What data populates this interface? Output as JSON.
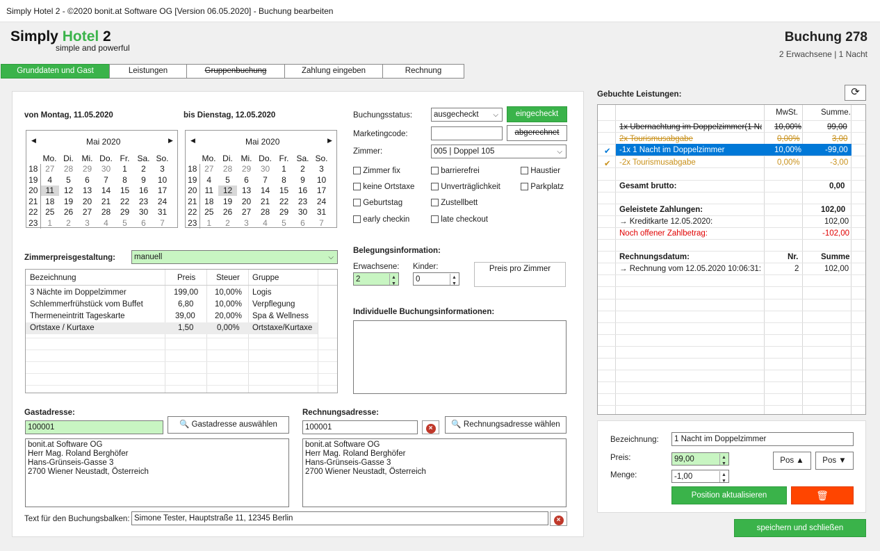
{
  "window_title": "Simply Hotel 2 - ©2020 bonit.at Software OG [Version 06.05.2020] - Buchung bearbeiten",
  "logo": {
    "a": "Simply",
    "b": "Hotel",
    "c": "2",
    "tagline": "simple and powerful"
  },
  "booking": {
    "title": "Buchung 278",
    "subtitle": "2 Erwachsene | 1 Nacht"
  },
  "tabs": [
    "Grunddaten und Gast",
    "Leistungen",
    "Gruppenbuchung",
    "Zahlung eingeben",
    "Rechnung"
  ],
  "from_label": "von Montag, 11.05.2020",
  "to_label": "bis Dienstag, 12.05.2020",
  "cal1": {
    "month": "Mai 2020",
    "days": [
      "Mo.",
      "Di.",
      "Mi.",
      "Do.",
      "Fr.",
      "Sa.",
      "So."
    ],
    "weeks": [
      [
        "18",
        "27",
        "28",
        "29",
        "30",
        "1",
        "2",
        "3"
      ],
      [
        "19",
        "4",
        "5",
        "6",
        "7",
        "8",
        "9",
        "10"
      ],
      [
        "20",
        "11",
        "12",
        "13",
        "14",
        "15",
        "16",
        "17"
      ],
      [
        "21",
        "18",
        "19",
        "20",
        "21",
        "22",
        "23",
        "24"
      ],
      [
        "22",
        "25",
        "26",
        "27",
        "28",
        "29",
        "30",
        "31"
      ],
      [
        "23",
        "1",
        "2",
        "3",
        "4",
        "5",
        "6",
        "7"
      ]
    ]
  },
  "cal2": {
    "month": "Mai 2020",
    "days": [
      "Mo.",
      "Di.",
      "Mi.",
      "Do.",
      "Fr.",
      "Sa.",
      "So."
    ]
  },
  "status": {
    "label": "Buchungsstatus:",
    "value": "ausgecheckt",
    "btn_checkin": "eingecheckt",
    "btn_billed": "abgerechnet"
  },
  "marketing": {
    "label": "Marketingcode:",
    "value": ""
  },
  "room": {
    "label": "Zimmer:",
    "value": "005 | Doppel 105"
  },
  "checkboxes": {
    "col1": [
      "Zimmer fix",
      "keine Ortstaxe",
      "Geburtstag",
      "early checkin"
    ],
    "col2": [
      "barrierefrei",
      "Unverträglichkeit",
      "Zustellbett",
      "late checkout"
    ],
    "col3": [
      "Haustier",
      "Parkplatz"
    ]
  },
  "pricing": {
    "label": "Zimmerpreisgestaltung:",
    "value": "manuell"
  },
  "price_table": {
    "headers": [
      "Bezeichnung",
      "Preis",
      "Steuer",
      "Gruppe"
    ],
    "rows": [
      [
        "3 Nächte im Doppelzimmer",
        "199,00",
        "10,00%",
        "Logis"
      ],
      [
        "Schlemmerfrühstück vom Buffet",
        "6,80",
        "10,00%",
        "Verpflegung"
      ],
      [
        "Thermeneintritt Tageskarte",
        "39,00",
        "20,00%",
        "Spa & Wellness"
      ],
      [
        "Ortstaxe / Kurtaxe",
        "1,50",
        "0,00%",
        "Ortstaxe/Kurtaxe"
      ]
    ]
  },
  "occupancy": {
    "label": "Belegungsinformation:",
    "adults_label": "Erwachsene:",
    "adults": "2",
    "children_label": "Kinder:",
    "children": "0",
    "price_per_room": "Preis pro Zimmer"
  },
  "individual_label": "Individuelle Buchungsinformationen:",
  "guest": {
    "label": "Gastadresse:",
    "id": "100001",
    "btn": "Gastadresse auswählen",
    "lines": [
      "bonit.at Software OG",
      "Herr Mag. Roland Berghöfer",
      "Hans-Grünseis-Gasse 3",
      "2700 Wiener Neustadt, Österreich"
    ]
  },
  "invoice": {
    "label": "Rechnungsadresse:",
    "id": "100001",
    "btn": "Rechnungsadresse wählen",
    "lines": [
      "bonit.at Software OG",
      "Herr Mag. Roland Berghöfer",
      "Hans-Grünseis-Gasse 3",
      "2700 Wiener Neustadt, Österreich"
    ]
  },
  "bar_text": {
    "label": "Text für den Buchungsbalken:",
    "value": "Simone Tester, Hauptstraße 11, 12345 Berlin"
  },
  "services": {
    "title": "Gebuchte Leistungen:",
    "col_tax": "MwSt.",
    "col_sum": "Summe.",
    "rows": [
      {
        "check": "",
        "name": "1x Übernachtung im Doppelzimmer(1 Na...",
        "tax": "10,00%",
        "sum": "99,00",
        "style": "strike"
      },
      {
        "check": "",
        "name": "2x Tourismusabgabe",
        "tax": "0,00%",
        "sum": "3,00",
        "style": "strike-orange"
      },
      {
        "check": "✔",
        "name": "-1x 1 Nacht im Doppelzimmer",
        "tax": "10,00%",
        "sum": "-99,00",
        "style": "selected"
      },
      {
        "check": "✔",
        "name": "-2x Tourismusabgabe",
        "tax": "0,00%",
        "sum": "-3,00",
        "style": "orange"
      }
    ],
    "gross_label": "Gesamt brutto:",
    "gross": "0,00",
    "payments_label": "Geleistete Zahlungen:",
    "payments": "102,00",
    "payment_line": "→  Kreditkarte 12.05.2020:",
    "payment_line_val": "102,00",
    "open_label": "Noch offener Zahlbetrag:",
    "open_val": "-102,00",
    "invoice_date_label": "Rechnungsdatum:",
    "nr_label": "Nr.",
    "sum_label": "Summe",
    "invoice_line": "→  Rechnung vom 12.05.2020 10:06:31:",
    "invoice_nr": "2",
    "invoice_sum": "102,00"
  },
  "edit": {
    "name_label": "Bezeichnung:",
    "name": "1 Nacht im Doppelzimmer",
    "price_label": "Preis:",
    "price": "99,00",
    "qty_label": "Menge:",
    "qty": "-1,00",
    "pos_up": "Pos ▲",
    "pos_down": "Pos ▼",
    "update": "Position aktualisieren"
  },
  "save": "speichern und schließen",
  "colors": {
    "accent": "#3ab34a",
    "select": "#0078d7",
    "danger": "#ff4500",
    "strike_orange": "#c8901a",
    "red_text": "#e00000"
  }
}
